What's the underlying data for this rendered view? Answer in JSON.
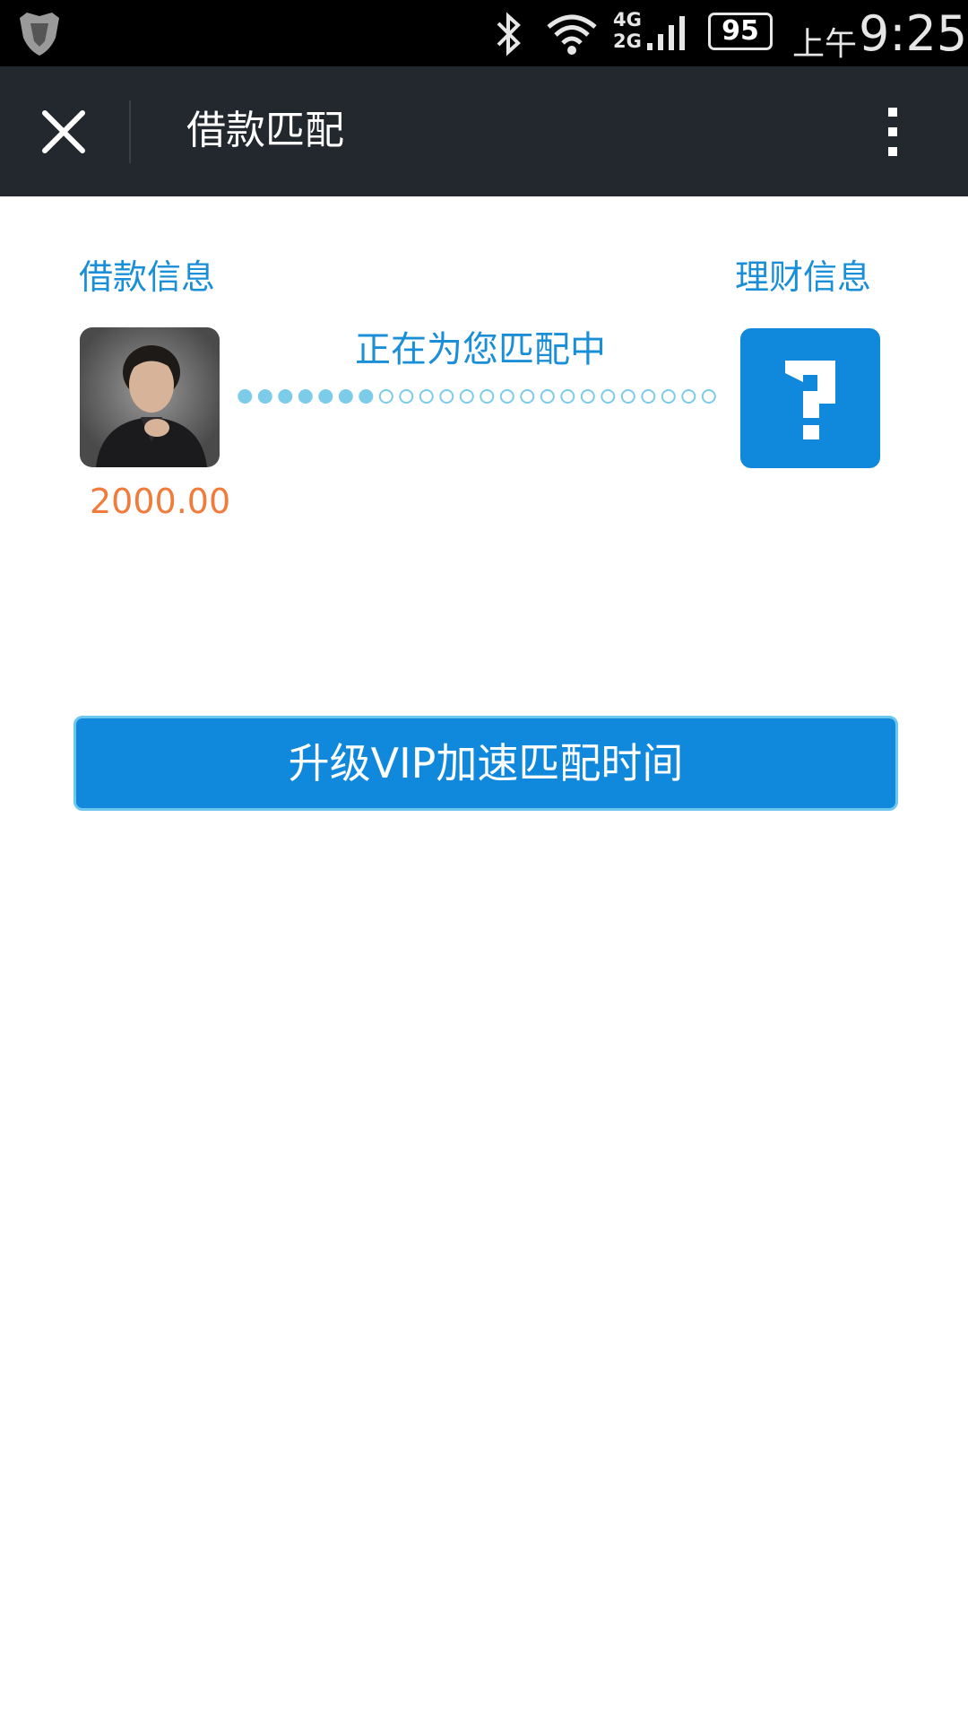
{
  "status_bar": {
    "network": "4G\n2G",
    "battery": "95",
    "ampm": "上午",
    "time": "9:25"
  },
  "app_bar": {
    "title": "借款匹配"
  },
  "loan_info": {
    "label": "借款信息",
    "amount": "2000.00"
  },
  "matching": {
    "status": "正在为您匹配中",
    "filled_dots": 7,
    "total_dots": 24
  },
  "finance_info": {
    "label": "理财信息"
  },
  "vip_button": {
    "label": "升级VIP加速匹配时间"
  },
  "colors": {
    "accent": "#1089dc",
    "amount": "#f07b3a",
    "dot": "#7bcbe9",
    "appbar": "#22282d"
  }
}
